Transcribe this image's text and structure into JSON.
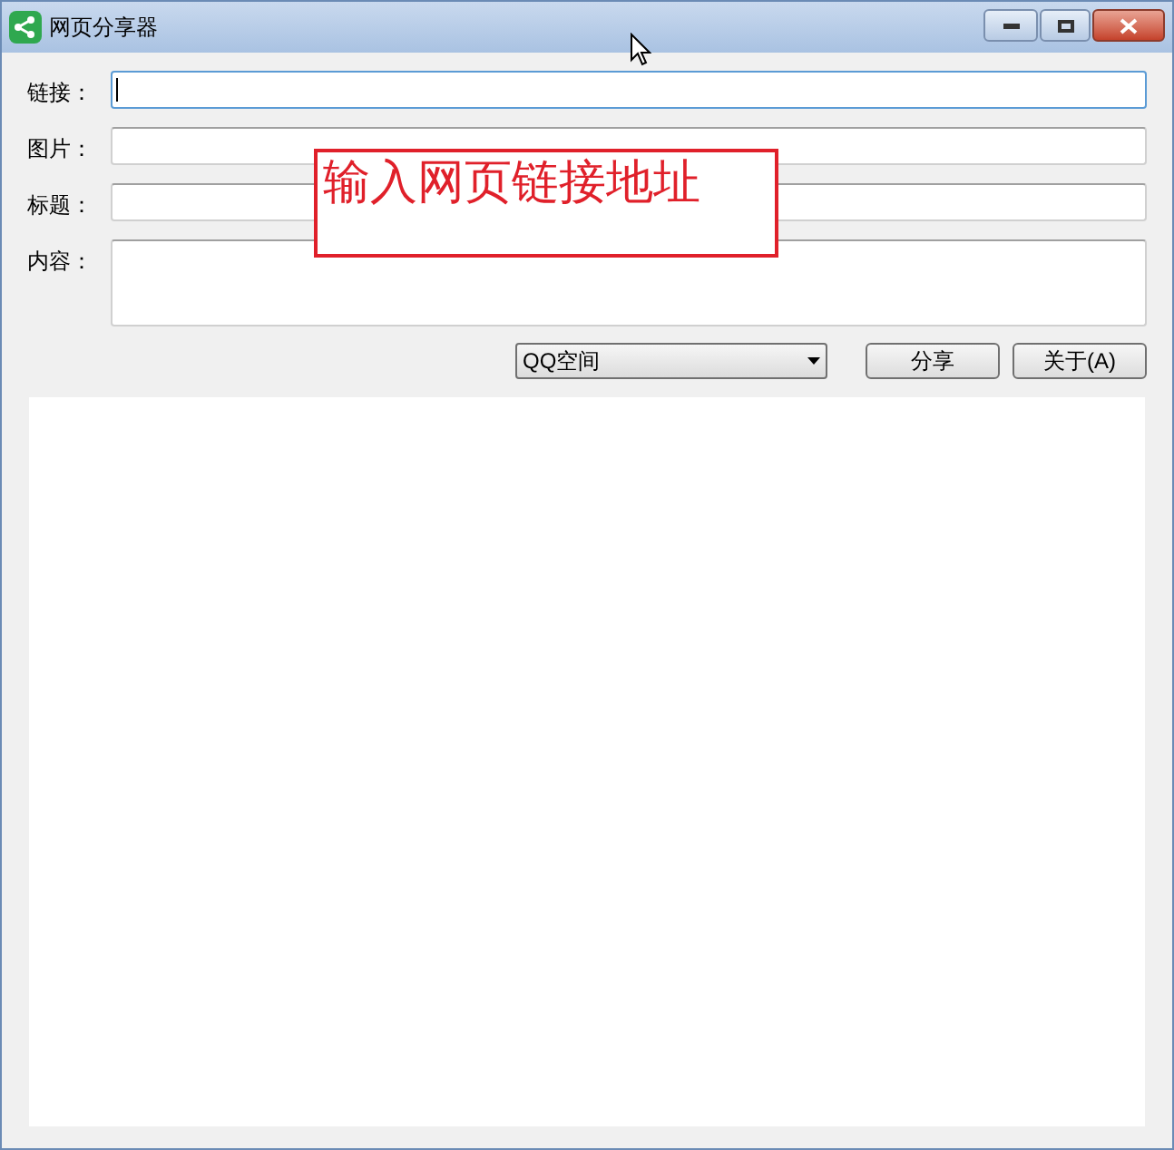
{
  "window": {
    "title": "网页分享器"
  },
  "fields": [
    {
      "label": "链接：",
      "focused": true,
      "kind": "line"
    },
    {
      "label": "图片：",
      "focused": false,
      "kind": "line"
    },
    {
      "label": "标题：",
      "focused": false,
      "kind": "line"
    },
    {
      "label": "内容：",
      "focused": false,
      "kind": "area"
    }
  ],
  "share_target": {
    "value": "QQ空间"
  },
  "buttons": [
    "分享",
    "关于(A)"
  ],
  "annotation": {
    "text": "输入网页链接地址"
  }
}
